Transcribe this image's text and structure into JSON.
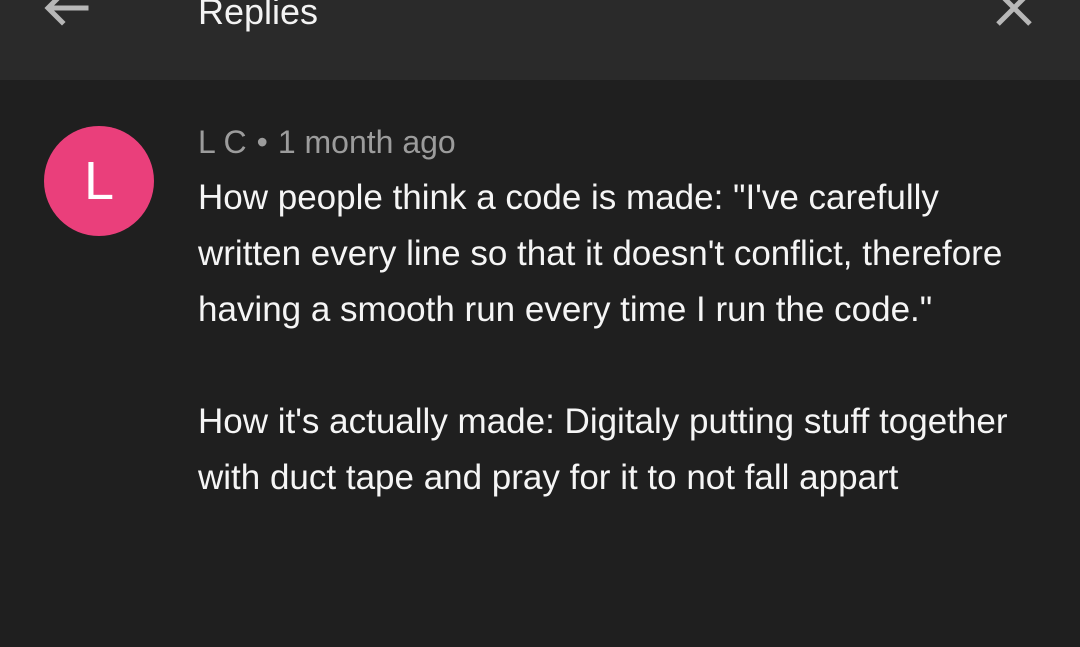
{
  "header": {
    "title": "Replies",
    "back_icon": "arrow-left-icon",
    "close_icon": "close-icon"
  },
  "comment": {
    "avatar_letter": "L",
    "avatar_color": "#ea3f7b",
    "author": "L C",
    "separator": "•",
    "time": "1 month ago",
    "paragraph_1": "How people think a code is made: \"I've carefully written every line so that it doesn't conflict, therefore having a smooth run every time I run the code.\"",
    "paragraph_2": "How it's actually made: Digitaly putting stuff together with duct tape and pray for it to not fall appart"
  }
}
